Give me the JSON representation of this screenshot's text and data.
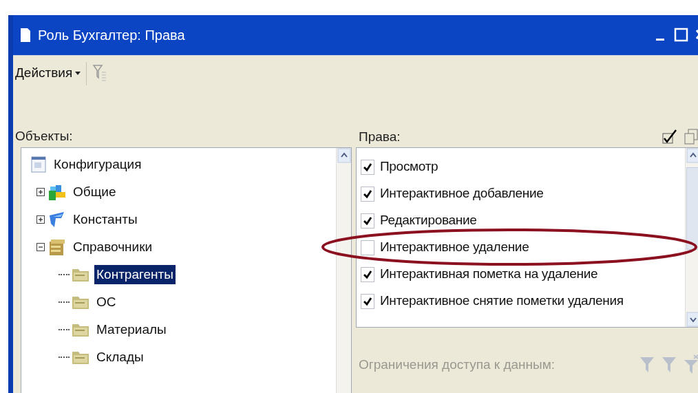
{
  "window": {
    "title": "Роль Бухгалтер: Права"
  },
  "toolbar": {
    "actions_menu": "Действия"
  },
  "objects": {
    "label": "Объекты:",
    "tree": [
      {
        "label": "Конфигурация",
        "kind": "config",
        "selected": false,
        "children": [
          {
            "label": "Общие",
            "kind": "common",
            "selected": false,
            "expanded": false
          },
          {
            "label": "Константы",
            "kind": "constants",
            "selected": false,
            "expanded": false
          },
          {
            "label": "Справочники",
            "kind": "catalogs",
            "selected": false,
            "expanded": true,
            "children": [
              {
                "label": "Контрагенты",
                "kind": "catalog",
                "selected": true
              },
              {
                "label": "ОС",
                "kind": "catalog",
                "selected": false
              },
              {
                "label": "Материалы",
                "kind": "catalog",
                "selected": false
              },
              {
                "label": "Склады",
                "kind": "catalog",
                "selected": false
              }
            ]
          }
        ]
      }
    ]
  },
  "rights": {
    "label": "Права:",
    "items": [
      {
        "label": "Просмотр",
        "checked": true
      },
      {
        "label": "Интерактивное добавление",
        "checked": true
      },
      {
        "label": "Редактирование",
        "checked": true
      },
      {
        "label": "Интерактивное удаление",
        "checked": false
      },
      {
        "label": "Интерактивная пометка на удаление",
        "checked": true
      },
      {
        "label": "Интерактивное снятие пометки удаления",
        "checked": true
      }
    ]
  },
  "restrictions": {
    "label": "Ограничения доступа к данным:",
    "disabled": true
  }
}
